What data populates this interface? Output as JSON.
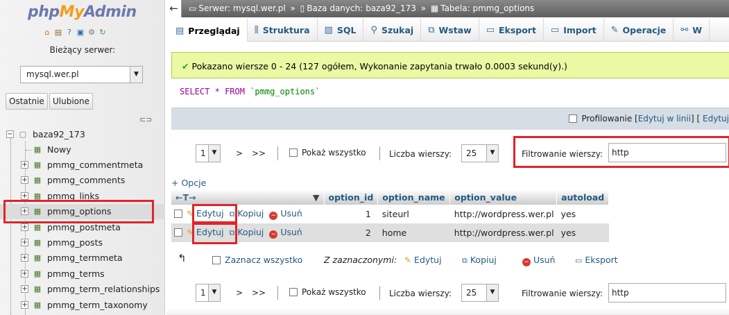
{
  "logo": {
    "php": "php",
    "my": "My",
    "admin": "Admin"
  },
  "nav": {
    "server_label": "Bieżący serwer:",
    "server_value": "mysql.wer.pl",
    "tab_recent": "Ostatnie",
    "tab_favorites": "Ulubione",
    "database": "baza92_173",
    "new_item": "Nowy",
    "tables": [
      "pmmg_commentmeta",
      "pmmg_comments",
      "pmmg_links",
      "pmmg_options",
      "pmmg_postmeta",
      "pmmg_posts",
      "pmmg_termmeta",
      "pmmg_terms",
      "pmmg_term_relationships",
      "pmmg_term_taxonomy"
    ],
    "selected_table": "pmmg_options"
  },
  "breadcrumb": {
    "server": "Serwer: mysql.wer.pl",
    "database": "Baza danych: baza92_173",
    "table": "Tabela: pmmg_options",
    "separator": "»"
  },
  "tabs": [
    "Przeglądaj",
    "Struktura",
    "SQL",
    "Szukaj",
    "Wstaw",
    "Eksport",
    "Import",
    "Operacje",
    "W"
  ],
  "active_tab": "Przeglądaj",
  "message": "Pokazano wiersze 0 - 24 (127 ogółem, Wykonanie zapytania trwało 0.0003 sekund(y).)",
  "sql": {
    "select": "SELECT",
    "star": "*",
    "from": "FROM",
    "table": "`pmmg_options`"
  },
  "profiling": {
    "label": "Profilowanie",
    "edit_inline": "Edytuj w linii",
    "edit": "Edytuj"
  },
  "pager": {
    "page": "1",
    "next": ">",
    "last": ">>",
    "show_all": "Pokaż wszystko",
    "rows_label": "Liczba wierszy:",
    "rows_value": "25",
    "filter_label": "Filtrowanie wierszy:",
    "filter_value": "http"
  },
  "options_link": "+ Opcje",
  "table": {
    "columns": [
      "option_id",
      "option_name",
      "option_value",
      "autoload"
    ],
    "sort_arrows": "←T→",
    "actions": {
      "edit": "Edytuj",
      "copy": "Kopiuj",
      "delete": "Usuń"
    },
    "rows": [
      {
        "option_id": "1",
        "option_name": "siteurl",
        "option_value": "http://wordpress.wer.pl",
        "autoload": "yes"
      },
      {
        "option_id": "2",
        "option_name": "home",
        "option_value": "http://wordpress.wer.pl",
        "autoload": "yes"
      }
    ]
  },
  "with_selected": {
    "check_all": "Zaznacz wszystko",
    "label": "Z zaznaczonymi:",
    "edit": "Edytuj",
    "copy": "Kopiuj",
    "delete": "Usuń",
    "export": "Eksport"
  },
  "colors": {
    "accent": "#235a81",
    "highlight": "#e0242b",
    "success_bg": "#ebf8a4"
  }
}
